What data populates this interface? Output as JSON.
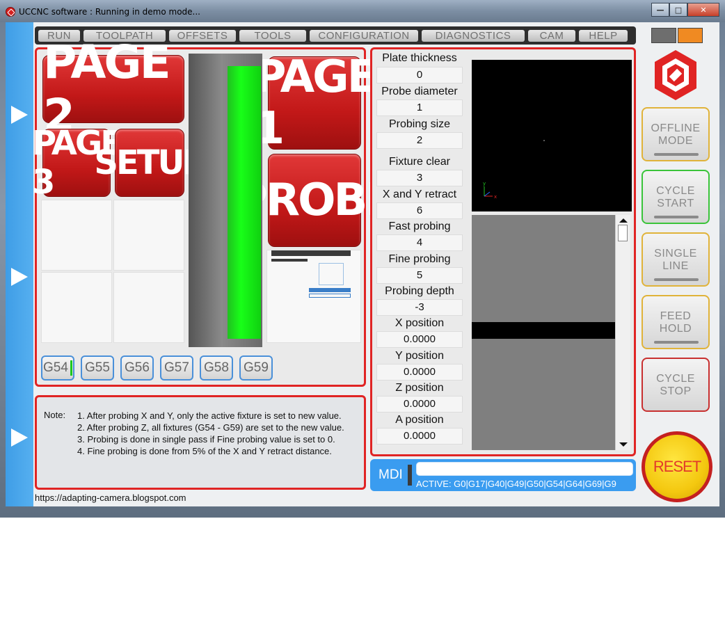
{
  "window": {
    "title": "UCCNC software : Running in demo mode...",
    "controls": [
      "minimize",
      "maximize",
      "close"
    ]
  },
  "menu": [
    "RUN",
    "TOOLPATH",
    "OFFSETS",
    "TOOLS",
    "CONFIGURATION",
    "DIAGNOSTICS",
    "CAM",
    "HELP"
  ],
  "screen_buttons": {
    "page2": "PAGE 2",
    "page1": "PAGE 1",
    "page3": "PAGE 3",
    "setup": "SETUP",
    "probe": "PROBE"
  },
  "fixtures": [
    "G54",
    "G55",
    "G56",
    "G57",
    "G58",
    "G59"
  ],
  "active_fixture": "G54",
  "probe_fields": [
    {
      "label": "Plate thickness",
      "value": "0"
    },
    {
      "label": "Probe diameter",
      "value": "1"
    },
    {
      "label": "Probing size",
      "value": "2"
    },
    {
      "label": "Fixture clear",
      "value": "3"
    },
    {
      "label": "X and Y retract",
      "value": "6"
    },
    {
      "label": "Fast probing",
      "value": "4"
    },
    {
      "label": "Fine probing",
      "value": "5"
    },
    {
      "label": "Probing depth",
      "value": "-3"
    },
    {
      "label": "X position",
      "value": "0.0000"
    },
    {
      "label": "Y position",
      "value": "0.0000"
    },
    {
      "label": "Z position",
      "value": "0.0000"
    },
    {
      "label": "A position",
      "value": "0.0000"
    }
  ],
  "note": {
    "label": "Note:",
    "lines": [
      "1. After probing X and Y, only the active fixture is set to new value.",
      "2. After probing Z, all fixtures (G54 - G59) are set to the new value.",
      "3. Probing is done in single pass if Fine probing value is set to 0.",
      "4. Fine probing is done from 5% of the X and Y retract distance."
    ]
  },
  "mdi": {
    "label": "MDI",
    "input_value": "",
    "active_codes": "ACTIVE: G0|G17|G40|G49|G50|G54|G64|G69|G9"
  },
  "side_buttons": [
    {
      "line1": "OFFLINE",
      "line2": "MODE",
      "border": "#e0b33a"
    },
    {
      "line1": "CYCLE",
      "line2": "START",
      "border": "#3ac43a"
    },
    {
      "line1": "SINGLE",
      "line2": "LINE",
      "border": "#e0b33a"
    },
    {
      "line1": "FEED",
      "line2": "HOLD",
      "border": "#e0b33a"
    },
    {
      "line1": "CYCLE",
      "line2": "STOP",
      "border": "#c83030"
    }
  ],
  "reset_label": "RESET",
  "status_url": "https://adapting-camera.blogspot.com",
  "colors": {
    "accent_red": "#e02424",
    "accent_blue": "#3a9cf0",
    "led_orange": "#f08a22",
    "bar_green": "#18ff18"
  }
}
